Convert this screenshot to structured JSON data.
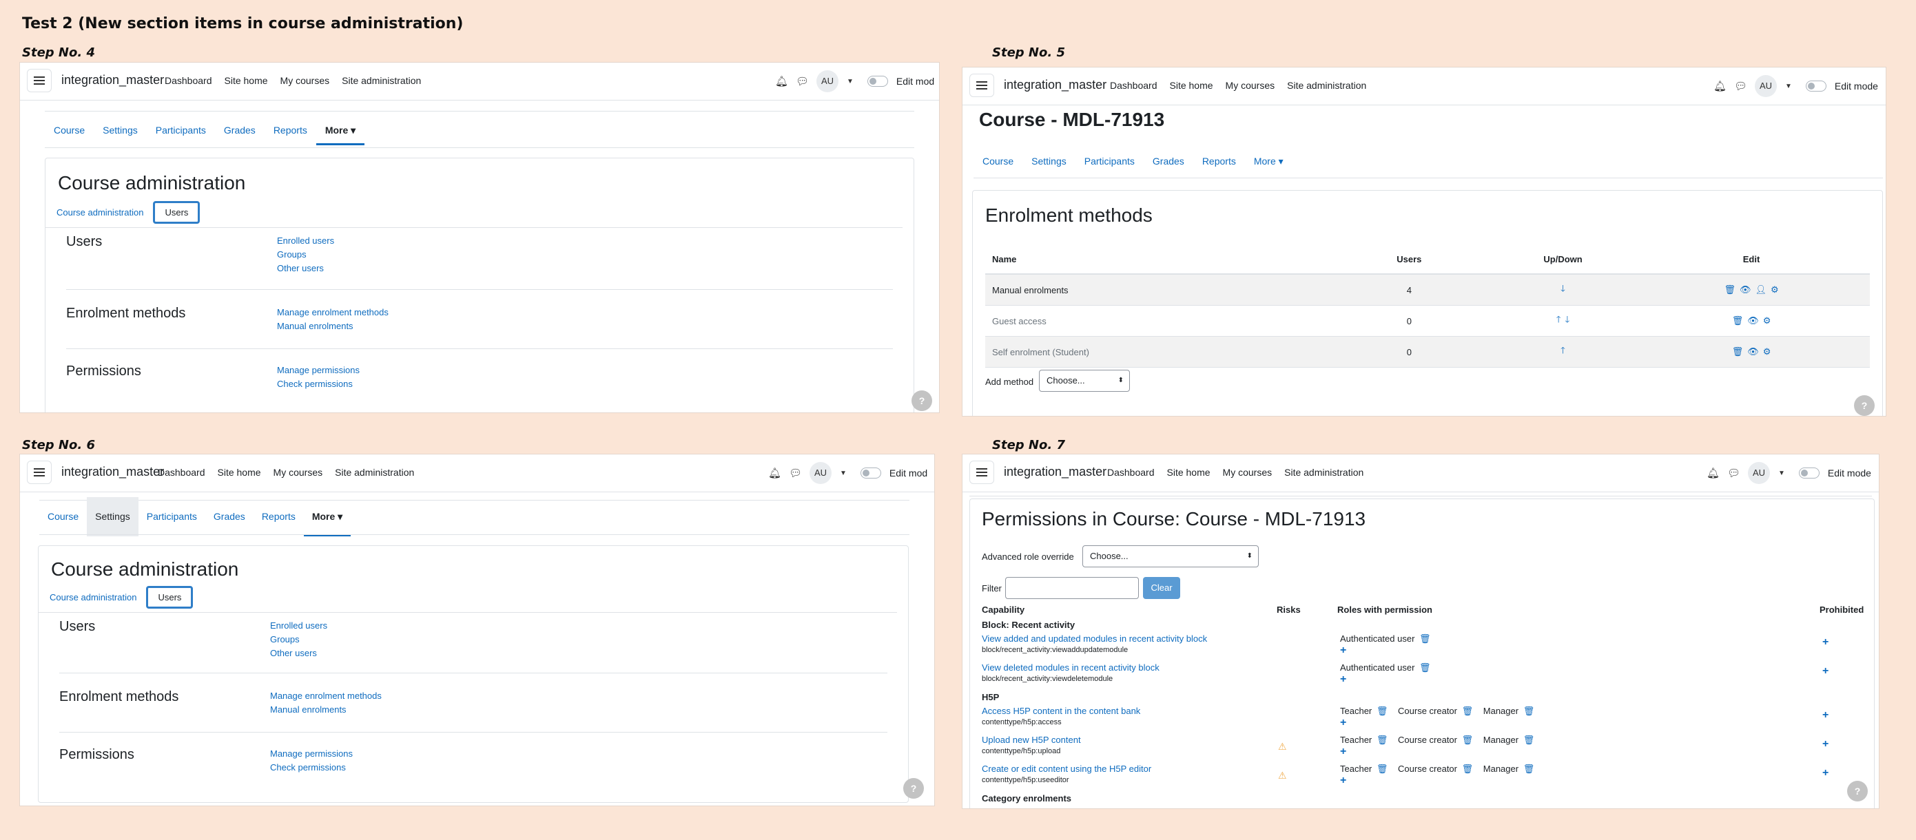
{
  "title": "Test 2 (New section items in course administration)",
  "steps": [
    "Step No. 4",
    "Step No. 5",
    "Step No. 6",
    "Step No. 7"
  ],
  "navbar": {
    "brand": "integration_master",
    "links": [
      "Dashboard",
      "Site home",
      "My courses",
      "Site administration"
    ],
    "avatar": "AU",
    "edit_mode": "Edit mode",
    "edit_mode_clipped": "Edit mod"
  },
  "secnav": [
    "Course",
    "Settings",
    "Participants",
    "Grades",
    "Reports",
    "More"
  ],
  "course_admin": {
    "heading": "Course administration",
    "tabs": [
      "Course administration",
      "Users"
    ],
    "sections": [
      {
        "title": "Users",
        "links": [
          "Enrolled users",
          "Groups",
          "Other users"
        ]
      },
      {
        "title": "Enrolment methods",
        "links": [
          "Manage enrolment methods",
          "Manual enrolments"
        ]
      },
      {
        "title": "Permissions",
        "links": [
          "Manage permissions",
          "Check permissions"
        ]
      }
    ]
  },
  "help": "?",
  "step5": {
    "course_title": "Course - MDL-71913",
    "heading": "Enrolment methods",
    "columns": [
      "Name",
      "Users",
      "Up/Down",
      "Edit"
    ],
    "rows": [
      {
        "name": "Manual enrolments",
        "users": "4"
      },
      {
        "name": "Guest access",
        "users": "0"
      },
      {
        "name": "Self enrolment (Student)",
        "users": "0"
      }
    ],
    "add_method_label": "Add method",
    "add_method_value": "Choose..."
  },
  "step7": {
    "heading": "Permissions in Course: Course - MDL-71913",
    "override_label": "Advanced role override",
    "override_value": "Choose...",
    "filter_label": "Filter",
    "clear": "Clear",
    "columns": [
      "Capability",
      "Risks",
      "Roles with permission",
      "Prohibited"
    ],
    "groups": [
      "Block: Recent activity",
      "H5P",
      "Category enrolments"
    ],
    "capabilities": [
      {
        "name": "View added and updated modules in recent activity block",
        "code": "block/recent_activity:viewaddupdatemodule",
        "roles": [
          "Authenticated user"
        ]
      },
      {
        "name": "View deleted modules in recent activity block",
        "code": "block/recent_activity:viewdeletemodule",
        "roles": [
          "Authenticated user"
        ]
      },
      {
        "name": "Access H5P content in the content bank",
        "code": "contenttype/h5p:access",
        "roles": [
          "Teacher",
          "Course creator",
          "Manager"
        ]
      },
      {
        "name": "Upload new H5P content",
        "code": "contenttype/h5p:upload",
        "roles": [
          "Teacher",
          "Course creator",
          "Manager"
        ]
      },
      {
        "name": "Create or edit content using the H5P editor",
        "code": "contenttype/h5p:useeditor",
        "roles": [
          "Teacher",
          "Course creator",
          "Manager"
        ]
      }
    ]
  }
}
